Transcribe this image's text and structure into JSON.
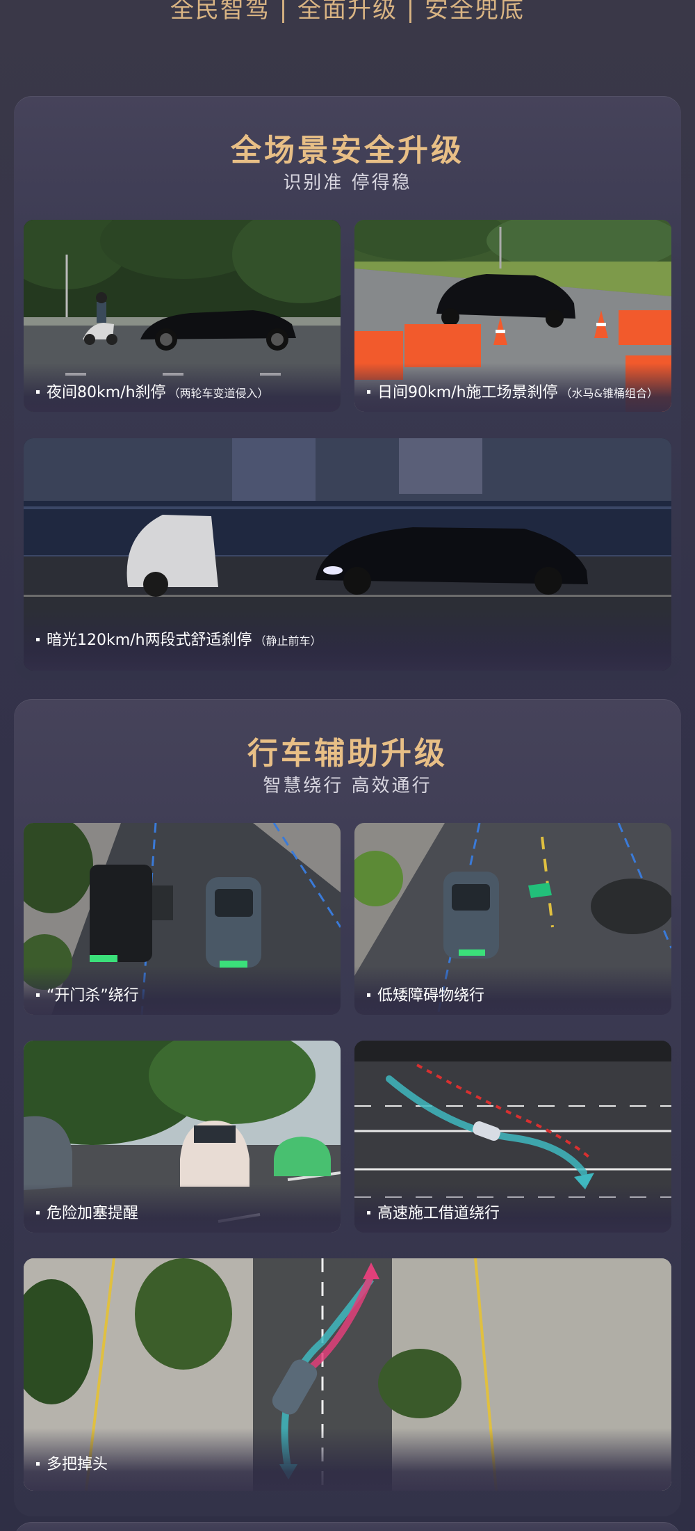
{
  "top_banner": {
    "text": "全民智驾 | 全面升级 | 安全兜底"
  },
  "section_safety": {
    "title": "全场景安全升级",
    "subtitle": "识别准 停得稳",
    "cards": [
      {
        "label": "夜间80km/h刹停",
        "note": "（两轮车变道侵入）"
      },
      {
        "label": "日间90km/h施工场景刹停",
        "note": "（水马&锥桶组合）"
      },
      {
        "label": "暗光120km/h两段式舒适刹停",
        "note": "（静止前车）"
      }
    ]
  },
  "section_driving": {
    "title": "行车辅助升级",
    "subtitle": "智慧绕行 高效通行",
    "cards": [
      {
        "label": "“开门杀”绕行"
      },
      {
        "label": "低矮障碍物绕行"
      },
      {
        "label": "危险加塞提醒"
      },
      {
        "label": "高速施工借道绕行"
      },
      {
        "label": "多把掉头"
      }
    ]
  },
  "colors": {
    "accent_gold": "#e8bf86",
    "background": "#35344a",
    "arrow_cyan": "#3fb8c0",
    "arrow_pink": "#e0407a",
    "barrier_orange": "#f25a2c"
  }
}
